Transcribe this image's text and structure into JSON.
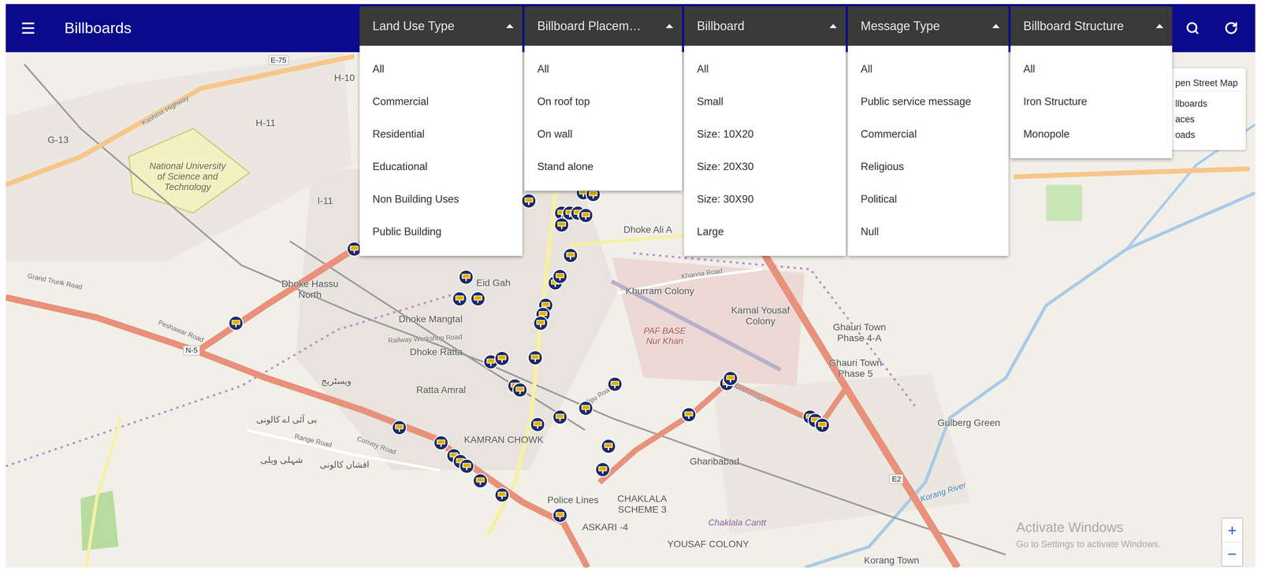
{
  "app": {
    "title": "Billboards"
  },
  "filters": [
    {
      "label": "Land Use Type",
      "expanded": true,
      "options": [
        "All",
        "Commercial",
        "Residential",
        "Educational",
        "Non Building Uses",
        "Public Building"
      ]
    },
    {
      "label": "Billboard Placem…",
      "expanded": true,
      "options": [
        "All",
        "On roof top",
        "On wall",
        "Stand alone"
      ]
    },
    {
      "label": "Billboard",
      "expanded": true,
      "options": [
        "All",
        "Small",
        "Size: 10X20",
        "Size: 20X30",
        "Size: 30X90",
        "Large"
      ]
    },
    {
      "label": "Message Type",
      "expanded": true,
      "options": [
        "All",
        "Public service message",
        "Commercial",
        "Religious",
        "Political",
        "Null"
      ]
    },
    {
      "label": "Billboard Structure",
      "expanded": true,
      "options": [
        "All",
        "Iron Structure",
        "Monopole"
      ]
    }
  ],
  "layers_panel": {
    "items": [
      "pen Street Map",
      "llboards",
      "aces",
      "oads"
    ]
  },
  "map": {
    "labels": [
      {
        "text": "National University of Science and Technology",
        "kind": "campus"
      },
      {
        "text": "H-11",
        "kind": "place"
      },
      {
        "text": "H-10",
        "kind": "place"
      },
      {
        "text": "G-13",
        "kind": "place"
      },
      {
        "text": "I-11",
        "kind": "place"
      },
      {
        "text": "Dhoke Hassu North",
        "kind": "place"
      },
      {
        "text": "Dhoke Mangtal",
        "kind": "place"
      },
      {
        "text": "Dhoke Ratta",
        "kind": "place"
      },
      {
        "text": "Ratta Amral",
        "kind": "place"
      },
      {
        "text": "KAMRAN CHOWK",
        "kind": "place"
      },
      {
        "text": "Eid Gah",
        "kind": "place"
      },
      {
        "text": "Dhoke Ali A",
        "kind": "place"
      },
      {
        "text": "Khurram Colony",
        "kind": "place"
      },
      {
        "text": "Karnal Yousaf Colony",
        "kind": "place"
      },
      {
        "text": "PAF BASE Nur Khan",
        "kind": "military"
      },
      {
        "text": "Ghauri Town Phase 4-A",
        "kind": "place"
      },
      {
        "text": "Ghauri Town Phase 5",
        "kind": "place"
      },
      {
        "text": "Gulberg Green",
        "kind": "place"
      },
      {
        "text": "Gharibabad",
        "kind": "place"
      },
      {
        "text": "CHAKLALA SCHEME 3",
        "kind": "place"
      },
      {
        "text": "Police Lines",
        "kind": "place"
      },
      {
        "text": "ASKARI -4",
        "kind": "place"
      },
      {
        "text": "YOUSAF COLONY",
        "kind": "place"
      },
      {
        "text": "Chaklala Cantt",
        "kind": "cantonment"
      },
      {
        "text": "Korang Town",
        "kind": "place"
      },
      {
        "text": "Korang River",
        "kind": "water"
      },
      {
        "text": "بی آئی اے کالونی",
        "kind": "urdu"
      },
      {
        "text": "شہلی ویلی",
        "kind": "urdu"
      },
      {
        "text": "افشاں کالونی",
        "kind": "urdu"
      },
      {
        "text": "ویسٹریج",
        "kind": "urdu"
      },
      {
        "text": "Grand Trunk Road",
        "kind": "road"
      },
      {
        "text": "Peshawar Road",
        "kind": "road"
      },
      {
        "text": "Kashmir Highway",
        "kind": "road"
      },
      {
        "text": "Airport Road",
        "kind": "road"
      },
      {
        "text": "Railway Workshop Road",
        "kind": "road"
      },
      {
        "text": "Range Road",
        "kind": "road"
      },
      {
        "text": "Convoy Road",
        "kind": "road"
      },
      {
        "text": "Tipu Road",
        "kind": "road"
      },
      {
        "text": "Khanna Road",
        "kind": "road"
      },
      {
        "text": "N-5",
        "kind": "badge"
      },
      {
        "text": "E2",
        "kind": "badge"
      },
      {
        "text": "E-75",
        "kind": "badge"
      }
    ]
  },
  "watermark": {
    "title": "Activate Windows",
    "subtitle": "Go to Settings to activate Windows."
  },
  "zoom": {
    "in": "+",
    "out": "−"
  }
}
